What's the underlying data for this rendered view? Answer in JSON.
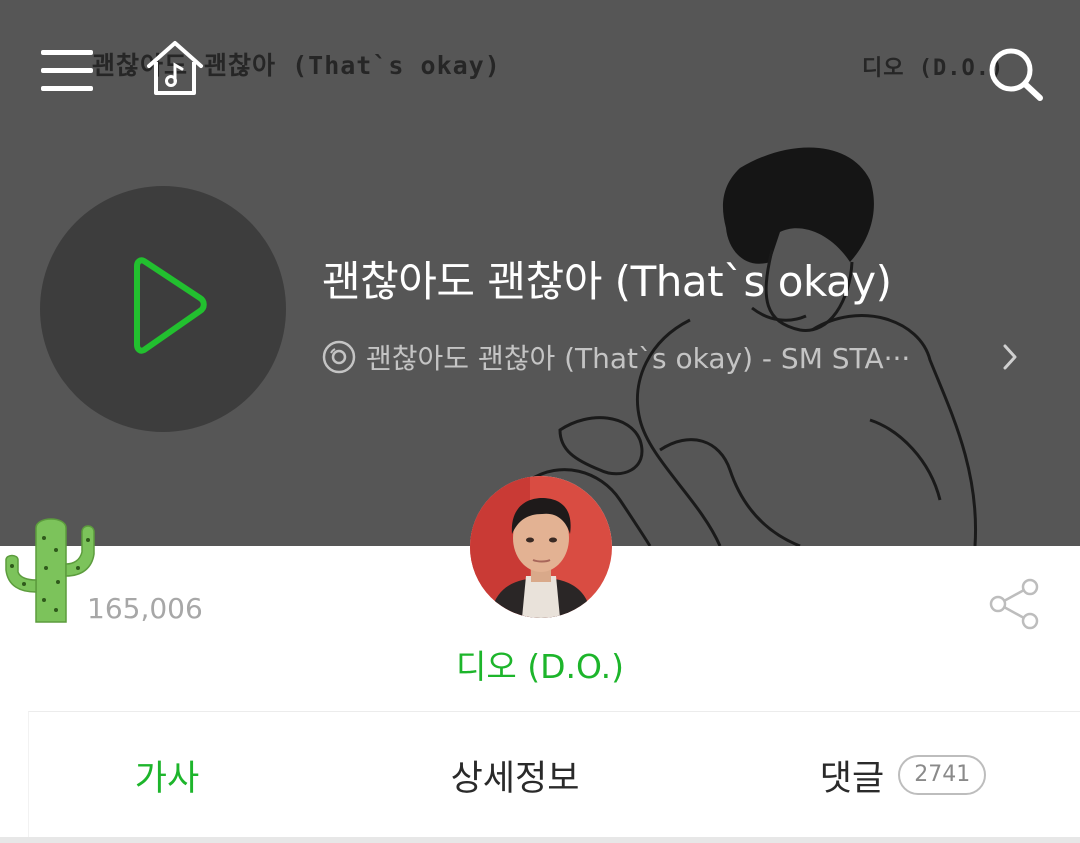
{
  "header": {
    "cover_text_left": "괜찮아도 괜찮아 (That`s okay)",
    "cover_text_right": "디오 (D.O.)"
  },
  "song": {
    "title": "괜찮아도 괜찮아 (That`s okay)",
    "album_line": "괜찮아도 괜찮아 (That`s okay) - SM STA···",
    "like_count": "165,006"
  },
  "artist": {
    "name": "디오 (D.O.)"
  },
  "tabs": [
    {
      "label": "가사",
      "active": true
    },
    {
      "label": "상세정보",
      "active": false
    },
    {
      "label": "댓글",
      "active": false,
      "badge": "2741"
    }
  ],
  "colors": {
    "accent": "#1db52b",
    "hero_bg": "#565656",
    "play_circle": "#3d3d3d"
  },
  "icons": {
    "menu": "hamburger-menu-icon",
    "home": "house-music-note-icon",
    "search": "magnifier-icon",
    "play": "play-triangle-icon",
    "album": "disc-icon",
    "chevron": "chevron-right-icon",
    "like": "cactus-icon",
    "share": "share-nodes-icon"
  }
}
